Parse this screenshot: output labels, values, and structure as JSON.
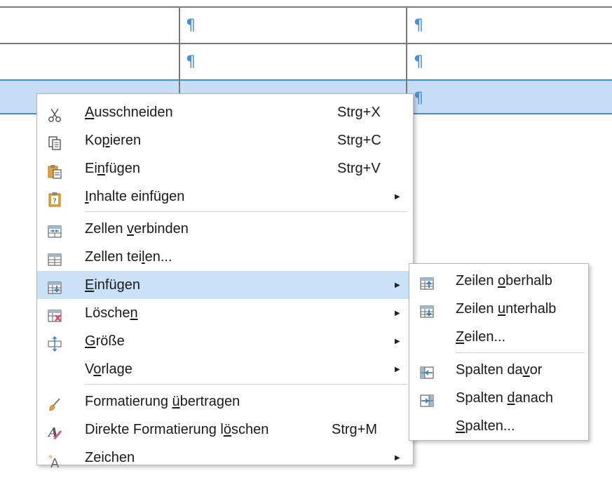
{
  "table": {
    "pilcrow": "¶"
  },
  "context_menu": {
    "items": [
      {
        "label_pre": "",
        "label_ul": "A",
        "label_post": "usschneiden",
        "shortcut": "Strg+X",
        "icon": "scissors-icon"
      },
      {
        "label_pre": "Ko",
        "label_ul": "p",
        "label_post": "ieren",
        "shortcut": "Strg+C",
        "icon": "copy-icon"
      },
      {
        "label_pre": "Ei",
        "label_ul": "n",
        "label_post": "fügen",
        "shortcut": "Strg+V",
        "icon": "paste-icon"
      },
      {
        "label_pre": "",
        "label_ul": "I",
        "label_post": "nhalte einfügen",
        "shortcut": "",
        "icon": "paste-special-icon",
        "submenu": true
      },
      {
        "label_pre": "Zellen ",
        "label_ul": "v",
        "label_post": "erbinden",
        "shortcut": "",
        "icon": "merge-cells-icon"
      },
      {
        "label_pre": "Zellen tei",
        "label_ul": "l",
        "label_post": "en...",
        "shortcut": "",
        "icon": "split-cells-icon"
      },
      {
        "label_pre": "",
        "label_ul": "E",
        "label_post": "infügen",
        "shortcut": "",
        "icon": "insert-table-icon",
        "submenu": true,
        "highlighted": true
      },
      {
        "label_pre": "Lösche",
        "label_ul": "n",
        "label_post": "",
        "shortcut": "",
        "icon": "delete-table-icon",
        "submenu": true
      },
      {
        "label_pre": "",
        "label_ul": "G",
        "label_post": "röße",
        "shortcut": "",
        "icon": "size-icon",
        "submenu": true
      },
      {
        "label_pre": "V",
        "label_ul": "o",
        "label_post": "rlage",
        "shortcut": "",
        "icon": "",
        "submenu": true
      },
      {
        "label_pre": "Formatierung ",
        "label_ul": "ü",
        "label_post": "bertragen",
        "shortcut": "",
        "icon": "format-paintbrush-icon"
      },
      {
        "label_pre": "Direkte Formatierung l",
        "label_ul": "ö",
        "label_post": "schen",
        "shortcut": "Strg+M",
        "icon": "clear-formatting-icon"
      },
      {
        "label_pre": "Zeichen",
        "label_ul": "",
        "label_post": "",
        "shortcut": "",
        "icon": "character-icon",
        "submenu": true
      }
    ]
  },
  "submenu": {
    "items": [
      {
        "label_pre": "Zeilen ",
        "label_ul": "o",
        "label_post": "berhalb",
        "icon": "insert-rows-above-icon"
      },
      {
        "label_pre": "Zeilen ",
        "label_ul": "u",
        "label_post": "nterhalb",
        "icon": "insert-rows-below-icon"
      },
      {
        "label_pre": "",
        "label_ul": "Z",
        "label_post": "eilen...",
        "icon": ""
      },
      {
        "label_pre": "Spalten da",
        "label_ul": "v",
        "label_post": "or",
        "icon": "insert-columns-before-icon"
      },
      {
        "label_pre": "Spalten ",
        "label_ul": "d",
        "label_post": "anach",
        "icon": "insert-columns-after-icon"
      },
      {
        "label_pre": "",
        "label_ul": "S",
        "label_post": "palten...",
        "icon": ""
      }
    ]
  },
  "colors": {
    "selection": "#c5def6",
    "highlight": "#c9e2f8",
    "pilcrow": "#4a90d8"
  }
}
